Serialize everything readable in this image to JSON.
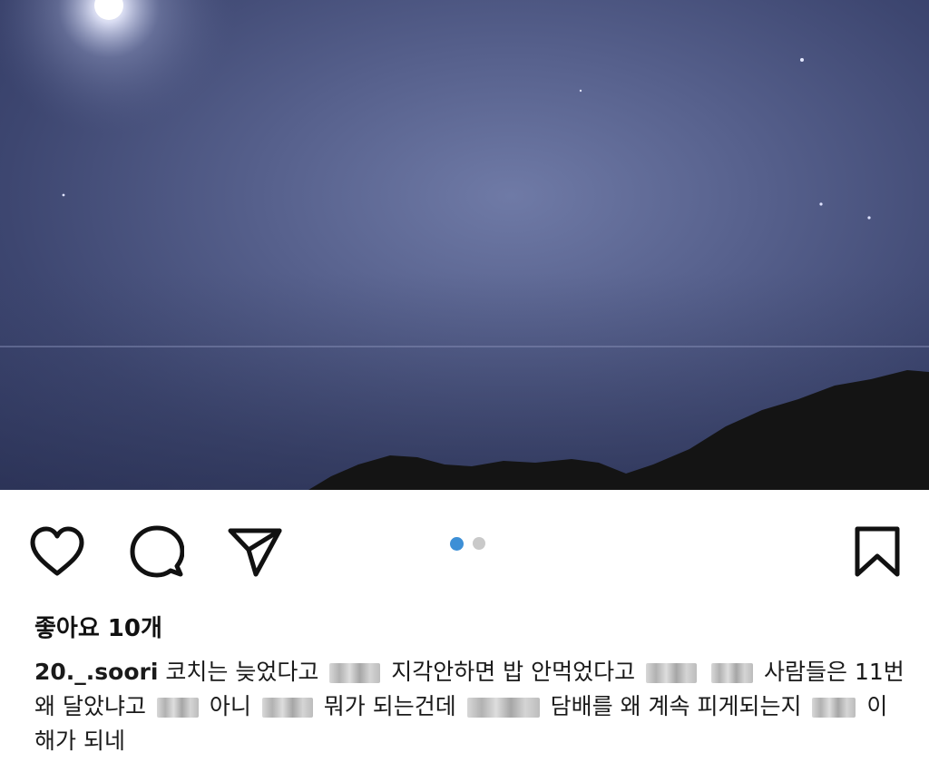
{
  "post": {
    "likes_text": "좋아요 10개",
    "username": "20._.soori",
    "caption_parts": [
      "코치는 늦었다고",
      "지각안하면 밥 안먹었다고",
      "사람들은 11번 왜 달았냐고",
      "아니",
      "뭐가 되는건데",
      "담배를 왜 계속 피게되는지",
      "이해가 되네"
    ],
    "carousel": {
      "current": 1,
      "total": 2
    },
    "colors": {
      "dot_active": "#3d8fd6",
      "dot_inactive": "#c9c9c9",
      "icon": "#111111"
    },
    "icons": {
      "like": "heart-icon",
      "comment": "comment-bubble-icon",
      "share": "paper-plane-icon",
      "save": "bookmark-icon"
    }
  }
}
